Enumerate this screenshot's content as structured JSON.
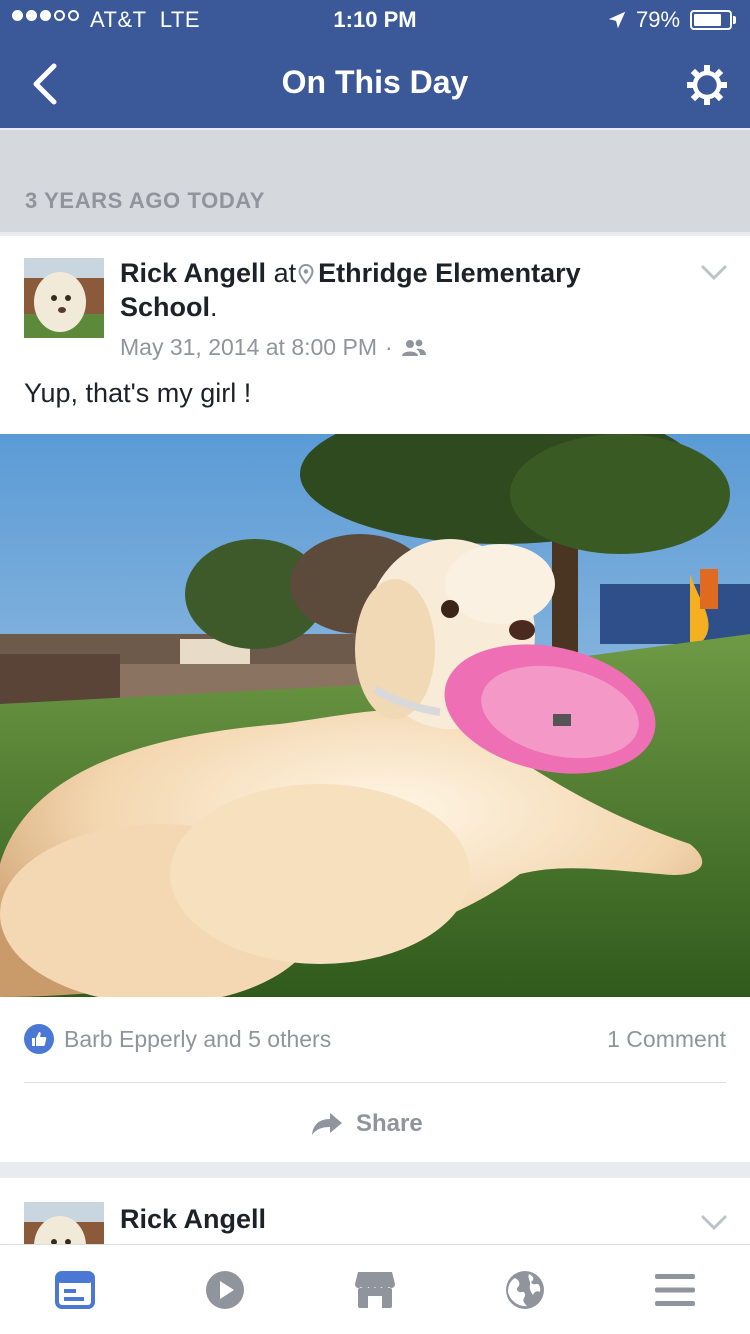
{
  "status_bar": {
    "carrier": "AT&T",
    "network": "LTE",
    "time": "1:10 PM",
    "battery_percent": "79%",
    "battery_level": 0.79,
    "signal_bars_filled": 3,
    "signal_bars_total": 5
  },
  "nav": {
    "title": "On This Day",
    "back_icon": "chevron-left-icon",
    "settings_icon": "gear-icon"
  },
  "memory": {
    "header": "3 YEARS AGO TODAY"
  },
  "post": {
    "author": "Rick Angell",
    "at_word": "at",
    "place": "Ethridge Elementary School",
    "place_suffix": ".",
    "timestamp": "May 31, 2014 at 8:00 PM",
    "separator": "·",
    "audience_icon": "friends-icon",
    "text": "Yup, that's my girl !",
    "likes": "Barb Epperly and 5 others",
    "comments": "1 Comment",
    "share_label": "Share"
  },
  "next_post": {
    "author": "Rick Angell"
  },
  "tab_bar": {
    "tabs": [
      {
        "icon": "news-feed-icon",
        "active": true
      },
      {
        "icon": "video-icon",
        "active": false
      },
      {
        "icon": "marketplace-icon",
        "active": false
      },
      {
        "icon": "notifications-globe-icon",
        "active": false
      },
      {
        "icon": "menu-icon",
        "active": false
      }
    ]
  },
  "colors": {
    "brand": "#3b5998",
    "like_badge": "#4a78d4",
    "active_tab": "#4a78d4",
    "muted": "#90949c"
  }
}
